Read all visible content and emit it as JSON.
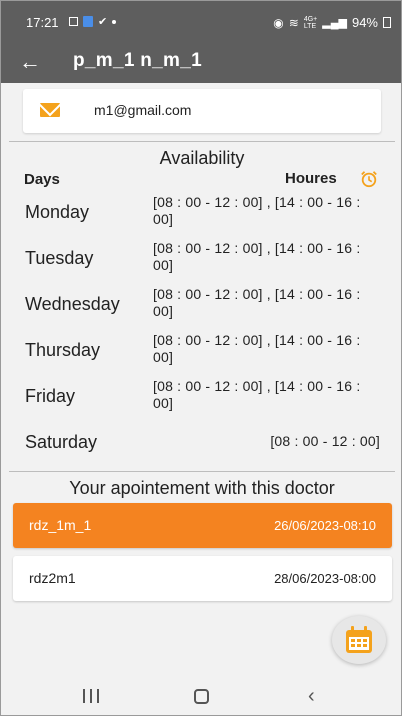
{
  "status_bar": {
    "time": "17:21",
    "battery": "94%",
    "network_top": "4G+",
    "network_bottom": "LTE"
  },
  "app_bar": {
    "title": "p_m_1 n_m_1",
    "back_icon": "arrow-left-icon"
  },
  "contact": {
    "email": "m1@gmail.com",
    "icon": "mail-icon"
  },
  "availability": {
    "title": "Availability",
    "days_header": "Days",
    "hours_header": "Houres",
    "alarm_icon": "alarm-clock-icon",
    "days": [
      {
        "day": "Monday",
        "hours": "[08 : 00 - 12 : 00] , [14 : 00 - 16 : 00]"
      },
      {
        "day": "Tuesday",
        "hours": "[08 : 00 - 12 : 00] , [14 : 00 - 16 : 00]"
      },
      {
        "day": "Wednesday",
        "hours": "[08 : 00 - 12 : 00] , [14 : 00 - 16 : 00]"
      },
      {
        "day": "Thursday",
        "hours": "[08 : 00 - 12 : 00] , [14 : 00 - 16 : 00]"
      },
      {
        "day": "Friday",
        "hours": "[08 : 00 - 12 : 00] , [14 : 00 - 16 : 00]"
      },
      {
        "day": "Saturday",
        "hours": "[08 : 00 - 12 : 00]"
      }
    ]
  },
  "appointments": {
    "title": "Your apointement with this doctor",
    "items": [
      {
        "name": "rdz_1m_1",
        "datetime": "26/06/2023-08:10",
        "selected": true
      },
      {
        "name": "rdz2m1",
        "datetime": "28/06/2023-08:00",
        "selected": false
      }
    ]
  },
  "fab": {
    "icon": "calendar-icon"
  },
  "colors": {
    "app_bar": "#5e5e5e",
    "accent": "#f48320",
    "icon_orange": "#f4a21c"
  }
}
